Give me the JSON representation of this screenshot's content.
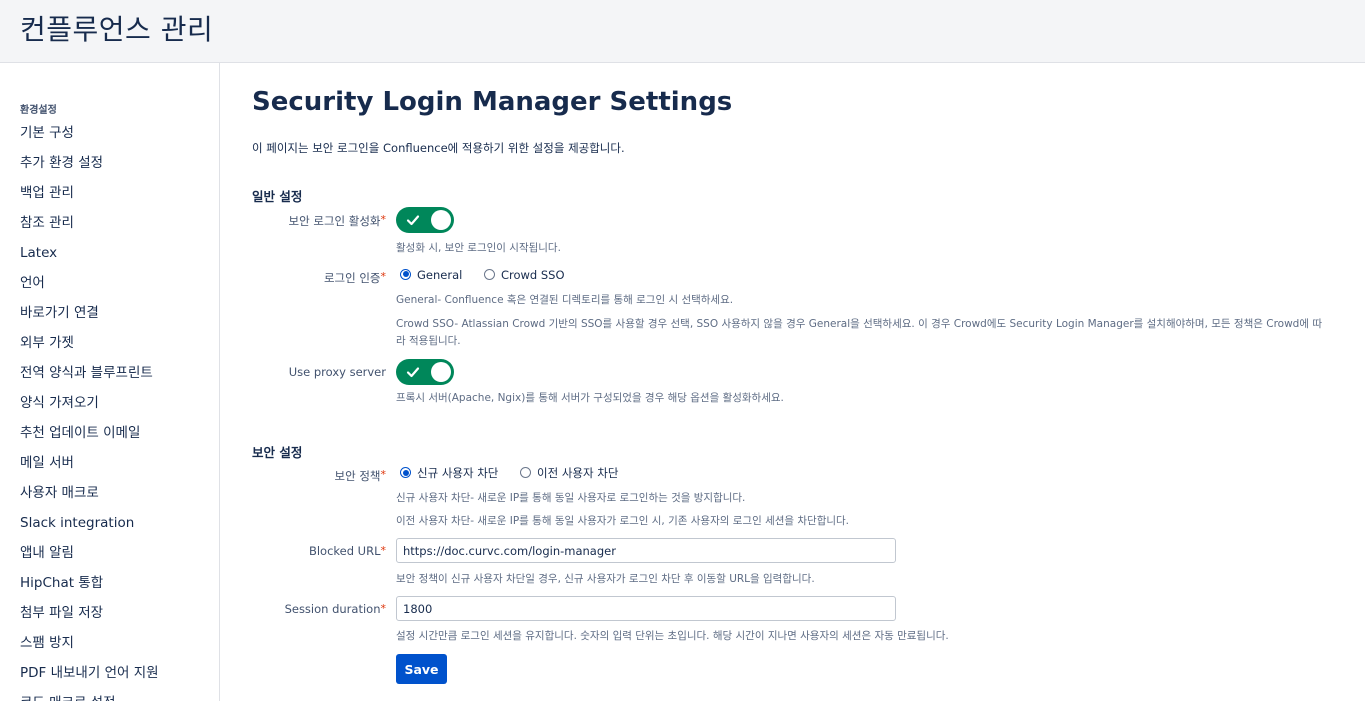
{
  "header": {
    "title": "컨플루언스 관리"
  },
  "sidebar": {
    "section_title": "환경설정",
    "items": [
      {
        "label": "기본 구성"
      },
      {
        "label": "추가 환경 설정"
      },
      {
        "label": "백업 관리"
      },
      {
        "label": "참조 관리"
      },
      {
        "label": "Latex"
      },
      {
        "label": "언어"
      },
      {
        "label": "바로가기 연결"
      },
      {
        "label": "외부 가젯"
      },
      {
        "label": "전역 양식과 블루프린트"
      },
      {
        "label": "양식 가져오기"
      },
      {
        "label": "추천 업데이트 이메일"
      },
      {
        "label": "메일 서버"
      },
      {
        "label": "사용자 매크로"
      },
      {
        "label": "Slack integration"
      },
      {
        "label": "앱내 알림"
      },
      {
        "label": "HipChat 통합"
      },
      {
        "label": "첨부 파일 저장"
      },
      {
        "label": "스팸 방지"
      },
      {
        "label": "PDF 내보내기 언어 지원"
      },
      {
        "label": "코드 매크로 설정"
      }
    ]
  },
  "main": {
    "title": "Security Login Manager Settings",
    "description": "이 페이지는 보안 로그인을 Confluence에 적용하기 위한 설정을 제공합니다.",
    "general": {
      "heading": "일반 설정",
      "enable_label": "보안 로그인 활성화",
      "required_mark": "*",
      "enable_help": "활성화 시, 보안 로그인이 시작됩니다.",
      "auth_label": "로그인 인증",
      "auth_options": [
        {
          "label": "General",
          "selected": true
        },
        {
          "label": "Crowd SSO",
          "selected": false
        }
      ],
      "auth_help_1": "General- Confluence 혹은 연결된 디렉토리를 통해 로그인 시 선택하세요.",
      "auth_help_2": "Crowd SSO- Atlassian Crowd 기반의 SSO를 사용할 경우 선택, SSO 사용하지 않을 경우 General을 선택하세요. 이 경우 Crowd에도 Security Login Manager를 설치해야하며, 모든 정책은 Crowd에 따",
      "auth_help_3": "라 적용됩니다.",
      "proxy_label": "Use proxy server",
      "proxy_help": "프록시 서버(Apache, Ngix)를 통해 서버가 구성되었을 경우 해당 옵션을 활성화하세요."
    },
    "security": {
      "heading": "보안 설정",
      "policy_label": "보안 정책",
      "policy_options": [
        {
          "label": "신규 사용자 차단",
          "selected": true
        },
        {
          "label": "이전 사용자 차단",
          "selected": false
        }
      ],
      "policy_help_1": "신규 사용자 차단- 새로운 IP를 통해 동일 사용자로 로그인하는 것을 방지합니다.",
      "policy_help_2": "이전 사용자 차단- 새로운 IP를 통해 동일 사용자가 로그인 시, 기존 사용자의 로그인 세션을 차단합니다.",
      "blocked_url_label": "Blocked URL",
      "blocked_url_value": "https://doc.curvc.com/login-manager",
      "blocked_url_help": "보안 정책이 신규 사용자 차단일 경우, 신규 사용자가 로그인 차단 후 이동할 URL을 입력합니다.",
      "session_label": "Session duration",
      "session_value": "1800",
      "session_help": "설정 시간만큼 로그인 세션을 유지합니다. 숫자의 입력 단위는 초입니다. 해당 시간이 지나면 사용자의 세션은 자동 만료됩니다."
    },
    "save_label": "Save"
  },
  "colors": {
    "toggle_on": "#00875a",
    "primary": "#0052cc",
    "required": "#de350b"
  },
  "icons": {
    "toggle_check": "check-icon"
  }
}
